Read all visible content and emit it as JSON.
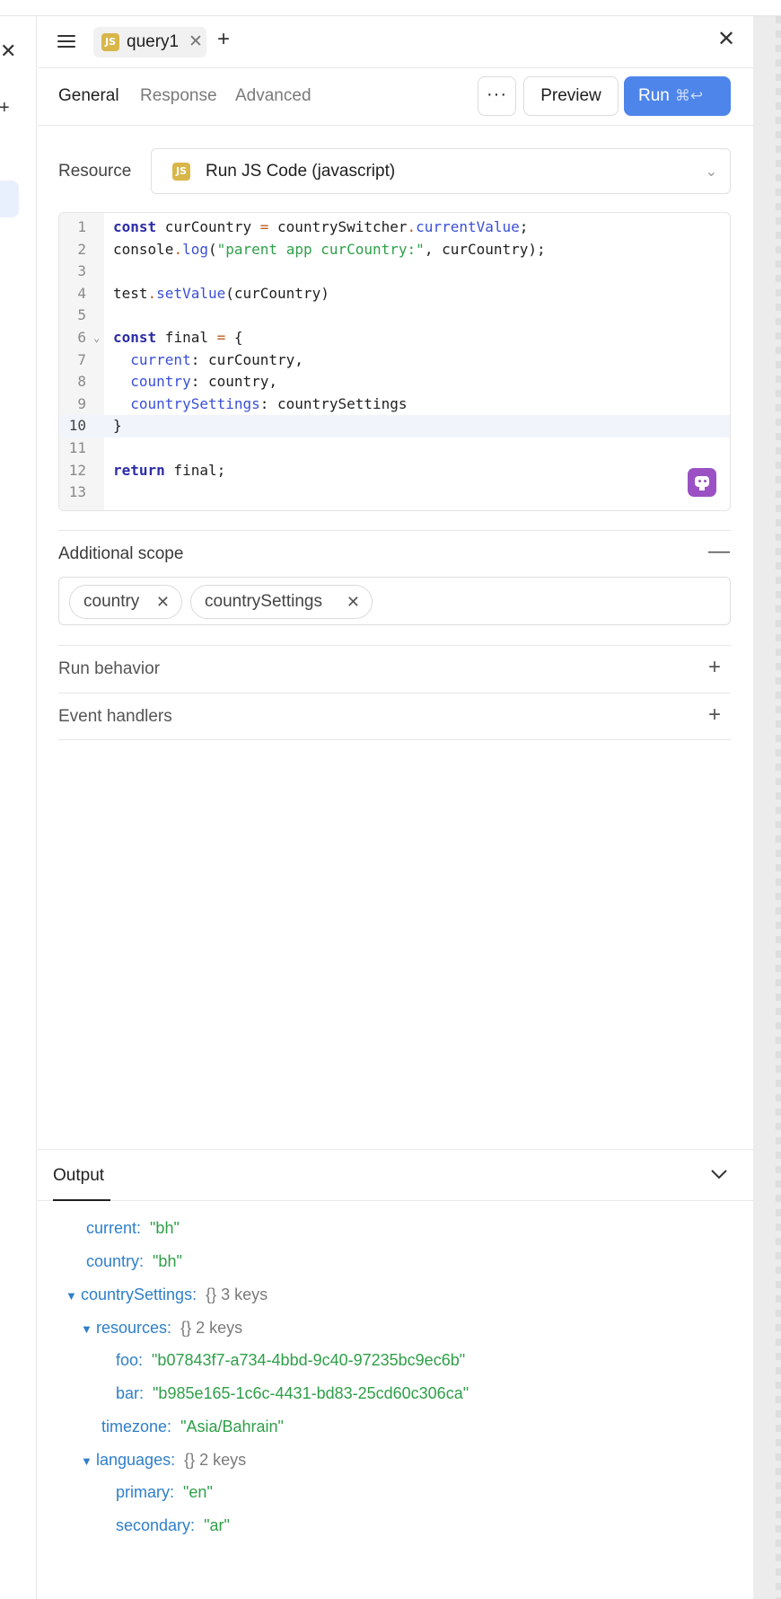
{
  "tabs": {
    "query_tab": "query1",
    "js_badge": "JS"
  },
  "subtabs": [
    "General",
    "Response",
    "Advanced"
  ],
  "toolbar": {
    "more_label": "···",
    "preview_label": "Preview",
    "run_label": "Run",
    "run_shortcut": "⌘↩"
  },
  "resource": {
    "label": "Resource",
    "badge": "JS",
    "value": "Run JS Code (javascript)"
  },
  "editor": {
    "line_numbers": [
      "1",
      "2",
      "3",
      "4",
      "5",
      "6",
      "7",
      "8",
      "9",
      "10",
      "11",
      "12",
      "13"
    ]
  },
  "additional_scope": {
    "title": "Additional scope",
    "chips": [
      "country",
      "countrySettings"
    ]
  },
  "run_behavior": {
    "title": "Run behavior"
  },
  "event_handlers": {
    "title": "Event handlers"
  },
  "output": {
    "tab_label": "Output",
    "tree": [
      {
        "key": "current:",
        "value": "\"bh\""
      },
      {
        "key": "country:",
        "value": "\"bh\""
      },
      {
        "key": "countrySettings:",
        "meta": "{}  3 keys"
      },
      {
        "key": "resources:",
        "meta": "{}  2 keys"
      },
      {
        "key": "foo:",
        "value": "\"b07843f7-a734-4bbd-9c40-97235bc9ec6b\""
      },
      {
        "key": "bar:",
        "value": "\"b985e165-1c6c-4431-bd83-25cd60c306ca\""
      },
      {
        "key": "timezone:",
        "value": "\"Asia/Bahrain\""
      },
      {
        "key": "languages:",
        "meta": "{}  2 keys"
      },
      {
        "key": "primary:",
        "value": "\"en\""
      },
      {
        "key": "secondary:",
        "value": "\"ar\""
      }
    ]
  },
  "colors": {
    "accent": "#4e85ea",
    "js_badge": "#d9b64a",
    "ai_button": "#9b51c4",
    "key": "#2f7fc9",
    "string": "#2e9f48"
  }
}
